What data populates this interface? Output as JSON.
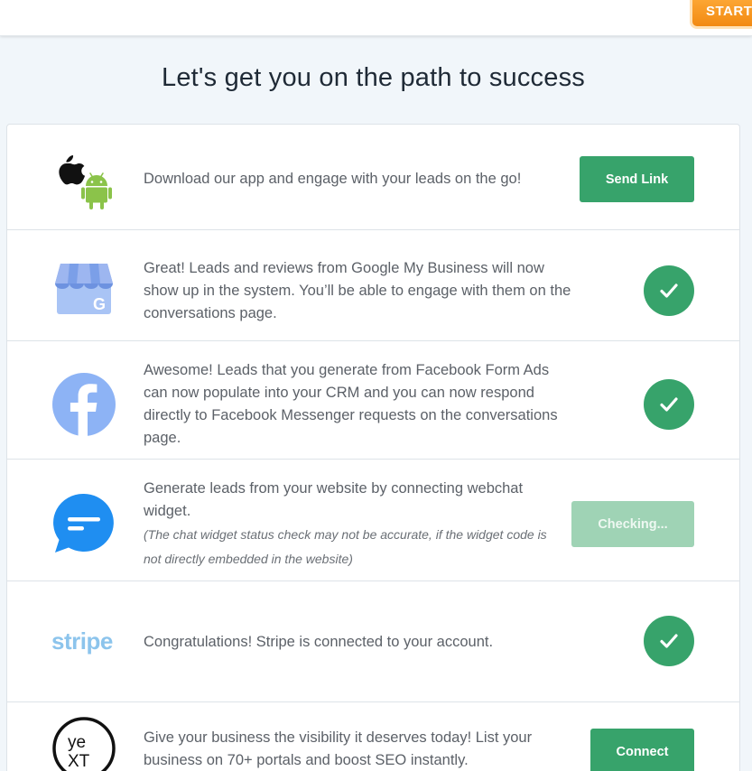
{
  "header": {
    "start_label": "START"
  },
  "page": {
    "title": "Let's get you on the path to success"
  },
  "rows": [
    {
      "id": "mobile-app",
      "icon": "apple-android-icon",
      "text": "Download our app and engage with your leads on the go!",
      "action": {
        "type": "button",
        "label": "Send Link"
      }
    },
    {
      "id": "google-my-business",
      "icon": "google-my-business-icon",
      "text": "Great! Leads and reviews from Google My Business will now show up in the system. You’ll be able to engage with them on the conversations page.",
      "action": {
        "type": "check",
        "state": "connected"
      }
    },
    {
      "id": "facebook",
      "icon": "facebook-icon",
      "text": "Awesome! Leads that you generate from Facebook Form Ads can now populate into your CRM and you can now respond directly to Facebook Messenger requests on the conversations page.",
      "action": {
        "type": "check",
        "state": "connected"
      }
    },
    {
      "id": "webchat",
      "icon": "chat-bubble-icon",
      "text": "Generate leads from your website by connecting webchat widget.",
      "note": "(The chat widget status check may not be accurate, if the widget code is not directly embedded in the website)",
      "action": {
        "type": "button",
        "label": "Checking...",
        "disabled": true
      }
    },
    {
      "id": "stripe",
      "icon": "stripe-logo",
      "logo_text": "stripe",
      "text": "Congratulations! Stripe is connected to your account.",
      "action": {
        "type": "check",
        "state": "connected"
      }
    },
    {
      "id": "yext",
      "icon": "yext-logo",
      "logo_text": "yext",
      "text": "Give your business the visibility it deserves today! List your business on 70+ portals and boost SEO instantly.",
      "action": {
        "type": "button",
        "label": "Connect"
      }
    }
  ],
  "colors": {
    "accent_green": "#37a36b",
    "disabled_green": "#9fd3b5",
    "start_orange": "#f28a12",
    "background": "#f1f6fa"
  }
}
